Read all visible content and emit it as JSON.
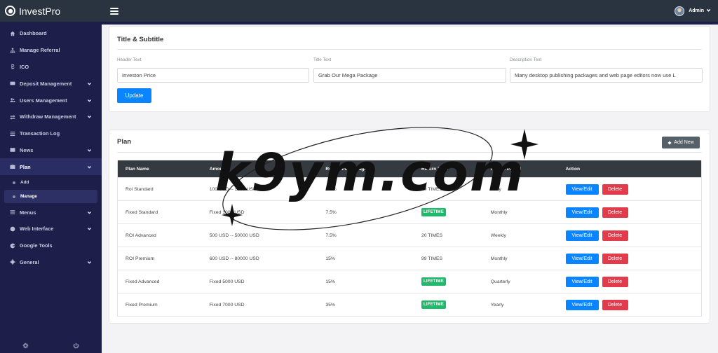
{
  "brand": {
    "name": "InvestPro"
  },
  "topbar": {
    "user_name": "Admin"
  },
  "sidebar": {
    "items": [
      {
        "label": "Dashboard",
        "icon": "home-icon",
        "chevron": false
      },
      {
        "label": "Manage Referral",
        "icon": "sitemap-icon",
        "chevron": false
      },
      {
        "label": "ICO",
        "icon": "bitcoin-icon",
        "chevron": false
      },
      {
        "label": "Deposit Management",
        "icon": "card-icon",
        "chevron": true
      },
      {
        "label": "Users Management",
        "icon": "users-icon",
        "chevron": true
      },
      {
        "label": "Withdraw Management",
        "icon": "exchange-icon",
        "chevron": true
      },
      {
        "label": "Transaction Log",
        "icon": "list-icon",
        "chevron": false
      },
      {
        "label": "News",
        "icon": "news-icon",
        "chevron": true
      },
      {
        "label": "Plan",
        "icon": "briefcase-icon",
        "chevron": true,
        "active": true
      },
      {
        "label": "Menus",
        "icon": "menu-icon",
        "chevron": true
      },
      {
        "label": "Web Interface",
        "icon": "globe-icon",
        "chevron": true
      },
      {
        "label": "Google Tools",
        "icon": "google-icon",
        "chevron": false
      },
      {
        "label": "General",
        "icon": "gear-icon",
        "chevron": true
      }
    ],
    "plan_sub": [
      {
        "label": "Add"
      },
      {
        "label": "Manage",
        "active": true
      }
    ]
  },
  "title_card": {
    "title": "Title & Subtitle",
    "fields": [
      {
        "label": "Header Text",
        "value": "Investon Price"
      },
      {
        "label": "Title Text",
        "value": "Grab Our Mega Package"
      },
      {
        "label": "Description Text",
        "value": "Many desktop publishing packages and web page editors now use L"
      }
    ],
    "update_label": "Update"
  },
  "plan_card": {
    "title": "Plan",
    "add_label": "Add New",
    "columns": [
      "Plan Name",
      "Amount",
      "Return Percentage",
      "Return Time",
      "Return Period",
      "Action"
    ],
    "rows": [
      {
        "name": "Roi Standard",
        "amount": "100 USD -- 1000 USD",
        "percent": "2.5%",
        "time": "10 TIMES",
        "time_badge": false,
        "period": "Daily"
      },
      {
        "name": "Fixed Standard",
        "amount": "Fixed 1000 USD",
        "percent": "7.5%",
        "time": "LIFETIME",
        "time_badge": true,
        "period": "Monthly"
      },
      {
        "name": "ROI Advanced",
        "amount": "500 USD -- 50000 USD",
        "percent": "7.5%",
        "time": "20 TIMES",
        "time_badge": false,
        "period": "Weekly"
      },
      {
        "name": "ROI Premium",
        "amount": "600 USD -- 80000 USD",
        "percent": "15%",
        "time": "99 TIMES",
        "time_badge": false,
        "period": "Monthly"
      },
      {
        "name": "Fixed Advanced",
        "amount": "Fixed 5000 USD",
        "percent": "15%",
        "time": "LIFETIME",
        "time_badge": true,
        "period": "Quarterly"
      },
      {
        "name": "Fixed Premium",
        "amount": "Fixed 7000 USD",
        "percent": "35%",
        "time": "LIFETIME",
        "time_badge": true,
        "period": "Yearly"
      }
    ],
    "view_label": "View/Edit",
    "delete_label": "Delete"
  },
  "watermark": {
    "text": "k9ym.com"
  },
  "colors": {
    "accent": "#0a84ff",
    "danger": "#e23b4c",
    "success": "#1fb96b",
    "sidebar": "#1d1f4a",
    "topbar": "#2a3441"
  }
}
